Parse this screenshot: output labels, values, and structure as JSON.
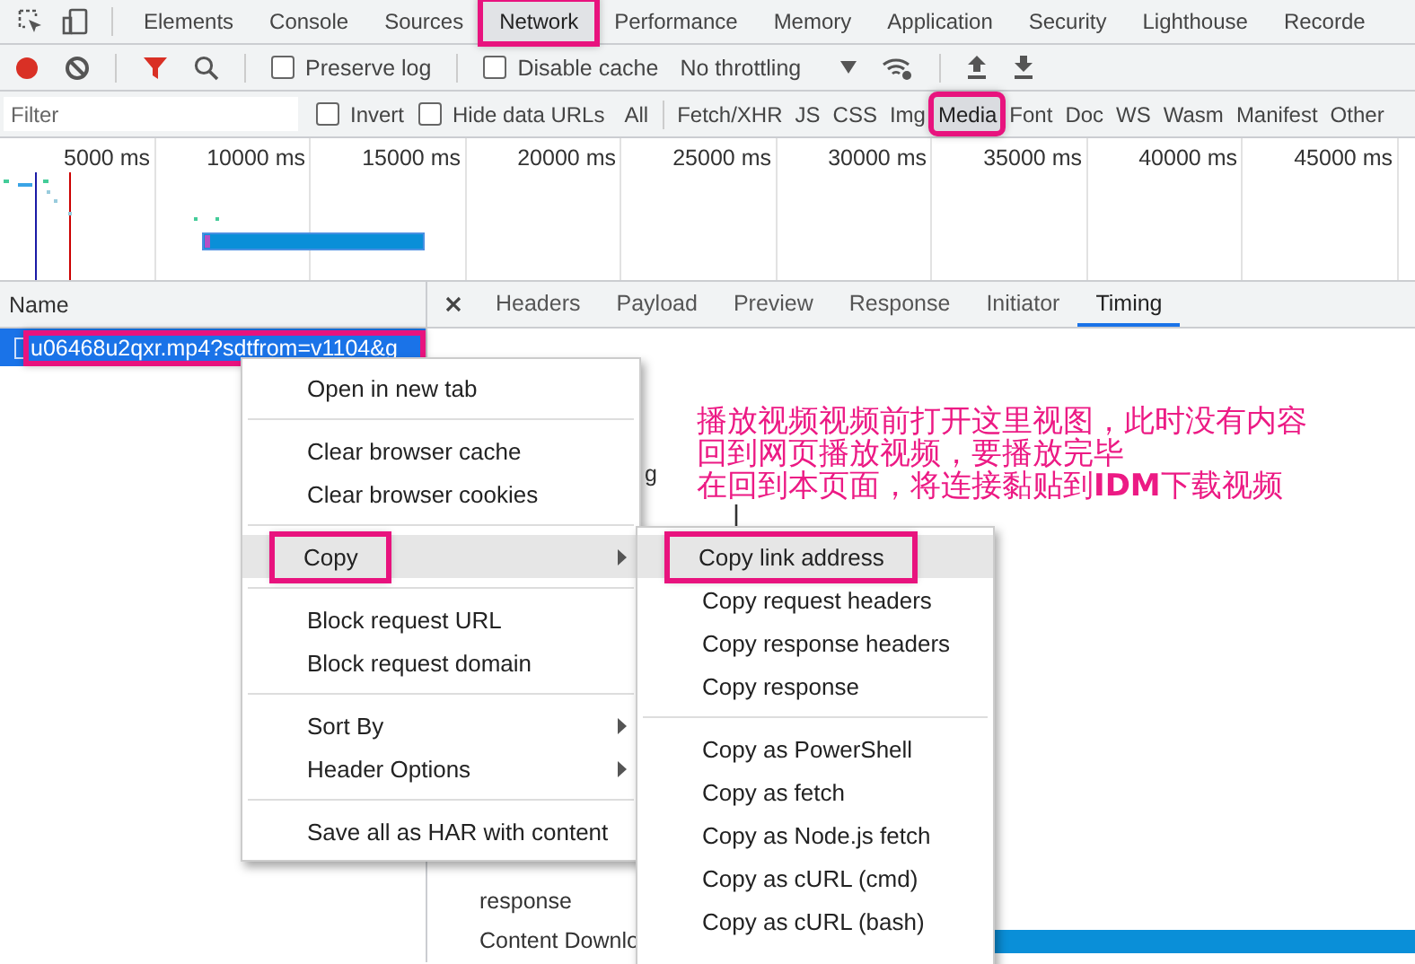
{
  "devtools_tabs": [
    {
      "label": "Elements",
      "selected": false,
      "highlighted": false
    },
    {
      "label": "Console",
      "selected": false,
      "highlighted": false
    },
    {
      "label": "Sources",
      "selected": false,
      "highlighted": false
    },
    {
      "label": "Network",
      "selected": true,
      "highlighted": true
    },
    {
      "label": "Performance",
      "selected": false,
      "highlighted": false
    },
    {
      "label": "Memory",
      "selected": false,
      "highlighted": false
    },
    {
      "label": "Application",
      "selected": false,
      "highlighted": false
    },
    {
      "label": "Security",
      "selected": false,
      "highlighted": false
    },
    {
      "label": "Lighthouse",
      "selected": false,
      "highlighted": false
    },
    {
      "label": "Recorde",
      "selected": false,
      "highlighted": false
    }
  ],
  "toolbar": {
    "preserve_log": {
      "label": "Preserve log",
      "checked": false
    },
    "disable_cache": {
      "label": "Disable cache",
      "checked": false
    },
    "throttling": "No throttling"
  },
  "filter": {
    "placeholder": "Filter",
    "invert": {
      "label": "Invert",
      "checked": false
    },
    "hide_data_urls": {
      "label": "Hide data URLs",
      "checked": false
    },
    "types": [
      {
        "label": "All",
        "selected": false,
        "highlighted": false
      },
      {
        "label": "Fetch/XHR",
        "selected": false,
        "highlighted": false
      },
      {
        "label": "JS",
        "selected": false,
        "highlighted": false
      },
      {
        "label": "CSS",
        "selected": false,
        "highlighted": false
      },
      {
        "label": "Img",
        "selected": false,
        "highlighted": false
      },
      {
        "label": "Media",
        "selected": true,
        "highlighted": true
      },
      {
        "label": "Font",
        "selected": false,
        "highlighted": false
      },
      {
        "label": "Doc",
        "selected": false,
        "highlighted": false
      },
      {
        "label": "WS",
        "selected": false,
        "highlighted": false
      },
      {
        "label": "Wasm",
        "selected": false,
        "highlighted": false
      },
      {
        "label": "Manifest",
        "selected": false,
        "highlighted": false
      },
      {
        "label": "Other",
        "selected": false,
        "highlighted": false
      }
    ]
  },
  "overview": {
    "ticks": [
      "5000 ms",
      "10000 ms",
      "15000 ms",
      "20000 ms",
      "25000 ms",
      "30000 ms",
      "35000 ms",
      "40000 ms",
      "45000 ms"
    ]
  },
  "requests": {
    "column": "Name",
    "rows": [
      {
        "name": "u06468u2qxr.mp4?sdtfrom=v1104&g",
        "selected": true,
        "highlighted": true
      }
    ]
  },
  "detail_tabs": [
    {
      "label": "Headers",
      "selected": false
    },
    {
      "label": "Payload",
      "selected": false
    },
    {
      "label": "Preview",
      "selected": false
    },
    {
      "label": "Response",
      "selected": false
    },
    {
      "label": "Initiator",
      "selected": false
    },
    {
      "label": "Timing",
      "selected": true
    }
  ],
  "timing": {
    "fragment": "g",
    "rows": [
      "response",
      "Content Downlo"
    ]
  },
  "annotation": {
    "lines": [
      "播放视频视频前打开这里视图，此时没有内容",
      "回到网页播放视频，要播放完毕",
      "在回到本页面，将连接黏贴到**IDM**下载视频"
    ]
  },
  "context_menu": {
    "groups": [
      [
        {
          "label": "Open in new tab",
          "submenu": false,
          "hovered": false,
          "highlighted": false
        }
      ],
      [
        {
          "label": "Clear browser cache",
          "submenu": false,
          "hovered": false,
          "highlighted": false
        },
        {
          "label": "Clear browser cookies",
          "submenu": false,
          "hovered": false,
          "highlighted": false
        }
      ],
      [
        {
          "label": "Copy",
          "submenu": true,
          "hovered": true,
          "highlighted": true
        }
      ],
      [
        {
          "label": "Block request URL",
          "submenu": false,
          "hovered": false,
          "highlighted": false
        },
        {
          "label": "Block request domain",
          "submenu": false,
          "hovered": false,
          "highlighted": false
        }
      ],
      [
        {
          "label": "Sort By",
          "submenu": true,
          "hovered": false,
          "highlighted": false
        },
        {
          "label": "Header Options",
          "submenu": true,
          "hovered": false,
          "highlighted": false
        }
      ],
      [
        {
          "label": "Save all as HAR with content",
          "submenu": false,
          "hovered": false,
          "highlighted": false
        }
      ]
    ]
  },
  "submenu": {
    "groups": [
      [
        {
          "label": "Copy link address",
          "hovered": true,
          "highlighted": true
        },
        {
          "label": "Copy request headers",
          "hovered": false,
          "highlighted": false
        },
        {
          "label": "Copy response headers",
          "hovered": false,
          "highlighted": false
        },
        {
          "label": "Copy response",
          "hovered": false,
          "highlighted": false
        }
      ],
      [
        {
          "label": "Copy as PowerShell",
          "hovered": false,
          "highlighted": false
        },
        {
          "label": "Copy as fetch",
          "hovered": false,
          "highlighted": false
        },
        {
          "label": "Copy as Node.js fetch",
          "hovered": false,
          "highlighted": false
        },
        {
          "label": "Copy as cURL (cmd)",
          "hovered": false,
          "highlighted": false
        },
        {
          "label": "Copy as cURL (bash)",
          "hovered": false,
          "highlighted": false
        }
      ]
    ]
  }
}
